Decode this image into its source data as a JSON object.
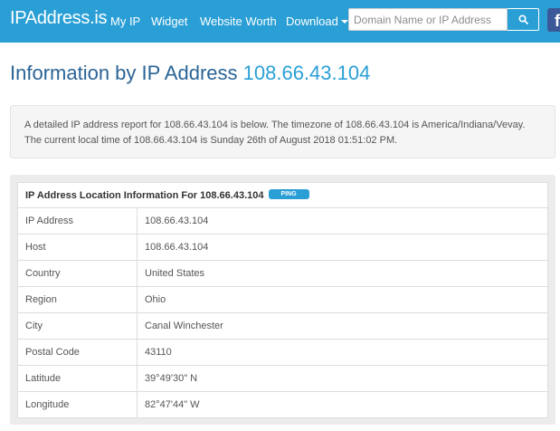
{
  "navbar": {
    "brand": "IPAddress.is",
    "links": {
      "my_ip": "My IP",
      "widget": "Widget",
      "website_worth": "Website Worth",
      "download": "Download"
    },
    "search_placeholder": "Domain Name or IP Address",
    "facebook_letter": "f",
    "accent_color": "#2a9fd6"
  },
  "page": {
    "title_prefix": "Information by IP Address",
    "title_ip": "108.66.43.104",
    "description_line1": "A detailed IP address report for 108.66.43.104 is below. The timezone of 108.66.43.104 is America/Indiana/Vevay.",
    "description_line2": "The current local time of 108.66.43.104 is Sunday 26th of August 2018 01:51:02 PM."
  },
  "table": {
    "header": "IP Address Location Information For 108.66.43.104",
    "ping_label": "PING",
    "rows": [
      {
        "label": "IP Address",
        "value": "108.66.43.104"
      },
      {
        "label": "Host",
        "value": "108.66.43.104"
      },
      {
        "label": "Country",
        "value": "United States"
      },
      {
        "label": "Region",
        "value": "Ohio"
      },
      {
        "label": "City",
        "value": "Canal Winchester"
      },
      {
        "label": "Postal Code",
        "value": "43110"
      },
      {
        "label": "Latitude",
        "value": "39°49'30\" N"
      },
      {
        "label": "Longitude",
        "value": "82°47'44\" W"
      }
    ]
  }
}
